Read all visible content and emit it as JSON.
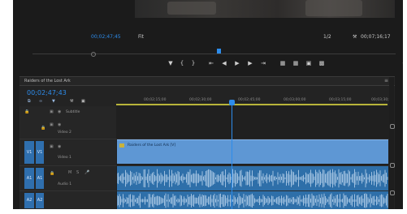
{
  "program_monitor": {
    "current_timecode": "00;02;47;45",
    "fit_label": "Fit",
    "quality_label": "1/2",
    "duration_timecode": "00;07;16;17"
  },
  "timeline": {
    "sequence_tab": "Raiders of the Lost Ark",
    "timecode": "00;02;47;43",
    "ruler_ticks": [
      "00;02;15;00",
      "00;02;30;00",
      "00;02;45;00",
      "00;03;00;00",
      "00;03;15;00",
      "00;03;30;00"
    ],
    "tracks": [
      {
        "id": "subtitle",
        "label": "Subtitle"
      },
      {
        "id": "v2",
        "label": "Video 2"
      },
      {
        "id": "v1",
        "label": "Video 1",
        "source_patch": "V1",
        "target": "V1"
      },
      {
        "id": "a1",
        "label": "Audio 1",
        "source_patch": "A1",
        "target": "A1"
      },
      {
        "id": "a2",
        "label": "",
        "source_patch": "A2",
        "target": "A2"
      }
    ],
    "clip_label": "Raiders of the Lost Ark [V]"
  },
  "colors": {
    "accent": "#2d8ceb",
    "video_clip": "#5e97d4",
    "audio_clip": "#2e6fa9",
    "work_area": "#b8b43a"
  },
  "icons": {
    "controls": [
      "marker-icon",
      "in-point-icon",
      "out-point-icon",
      "go-to-in-icon",
      "step-back-icon",
      "play-icon",
      "step-forward-icon",
      "go-to-out-icon",
      "lift-icon",
      "extract-icon",
      "export-frame-icon",
      "button-editor-icon"
    ],
    "timeline_tools": [
      "snap-icon",
      "linked-selection-icon",
      "add-marker-icon",
      "wrench-icon",
      "captions-icon"
    ]
  }
}
